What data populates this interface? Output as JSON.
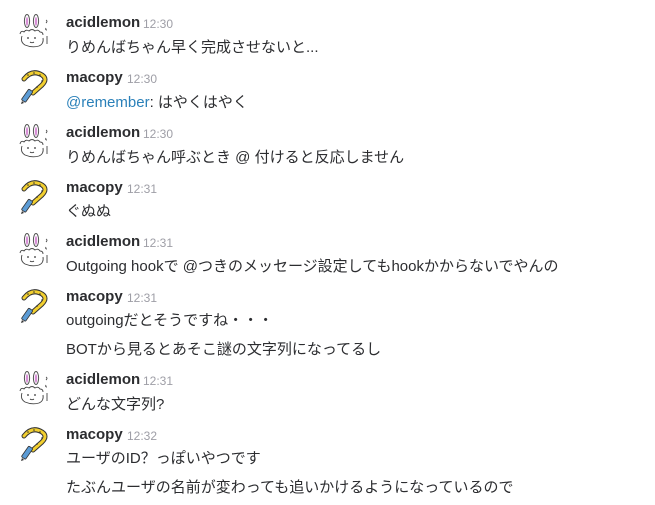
{
  "users": {
    "acidlemon": {
      "name": "acidlemon",
      "avatar_icon": "bunny-doodle-icon"
    },
    "macopy": {
      "name": "macopy",
      "avatar_icon": "snake-pencil-icon"
    }
  },
  "colors": {
    "mention": "#2a80b9",
    "timestamp": "#9e9ea6",
    "text": "#2c2d30"
  },
  "messages": [
    {
      "author": "acidlemon",
      "time": "12:30",
      "lines": [
        "りめんばちゃん早く完成させないと..."
      ]
    },
    {
      "author": "macopy",
      "time": "12:30",
      "mention": "@remember",
      "lines": [
        ": はやくはやく"
      ]
    },
    {
      "author": "acidlemon",
      "time": "12:30",
      "lines": [
        "りめんばちゃん呼ぶとき @ 付けると反応しません"
      ]
    },
    {
      "author": "macopy",
      "time": "12:31",
      "lines": [
        "ぐぬぬ"
      ]
    },
    {
      "author": "acidlemon",
      "time": "12:31",
      "lines": [
        "Outgoing hookで @つきのメッセージ設定してもhookかからないでやんの"
      ]
    },
    {
      "author": "macopy",
      "time": "12:31",
      "lines": [
        "outgoingだとそうですね・・・",
        "BOTから見るとあそこ謎の文字列になってるし"
      ]
    },
    {
      "author": "acidlemon",
      "time": "12:31",
      "lines": [
        "どんな文字列?"
      ]
    },
    {
      "author": "macopy",
      "time": "12:32",
      "lines": [
        "ユーザのID？っぽいやつです",
        "たぶんユーザの名前が変わっても追いかけるようになっているので"
      ]
    }
  ]
}
